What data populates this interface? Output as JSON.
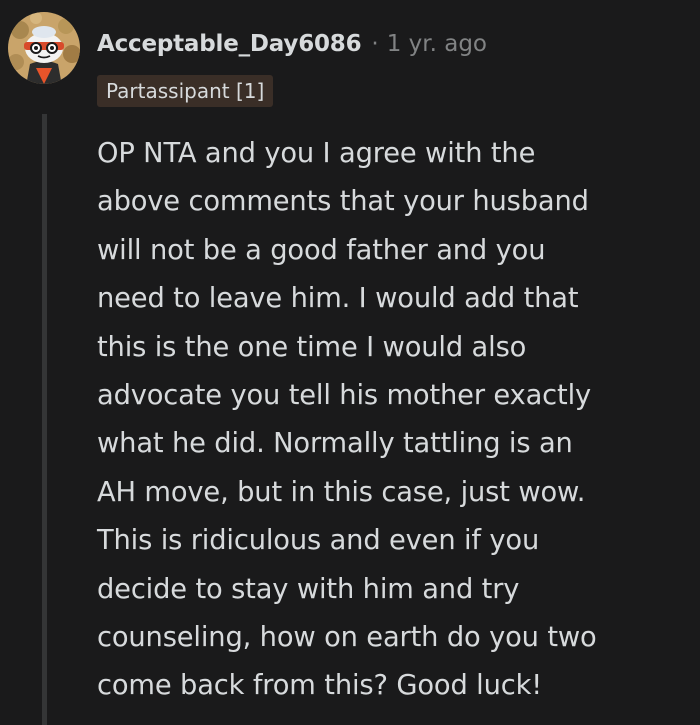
{
  "comment": {
    "author": "Acceptable_Day6086",
    "separator": "·",
    "time_ago": "1 yr. ago",
    "flair": "Partassipant [1]",
    "body_lines": [
      "OP NTA and you I agree with the",
      "above comments that your husband",
      "will not be a good father and you",
      "need to leave him. I would add that",
      "this is the one time I would also",
      "advocate you tell his mother exactly",
      "what he did. Normally tattling is an",
      "AH move, but in this case, just wow.",
      "This is ridiculous and even if you",
      "decide to stay with him and try",
      "counseling, how on earth do you two",
      "come back from this? Good luck!"
    ],
    "avatar_icon": "snoo-avatar-icon"
  },
  "colors": {
    "background": "#1a1a1b",
    "text": "#d7dadc",
    "muted": "#818384",
    "flair_bg": "#3a2e27",
    "thread_line": "#343536"
  }
}
